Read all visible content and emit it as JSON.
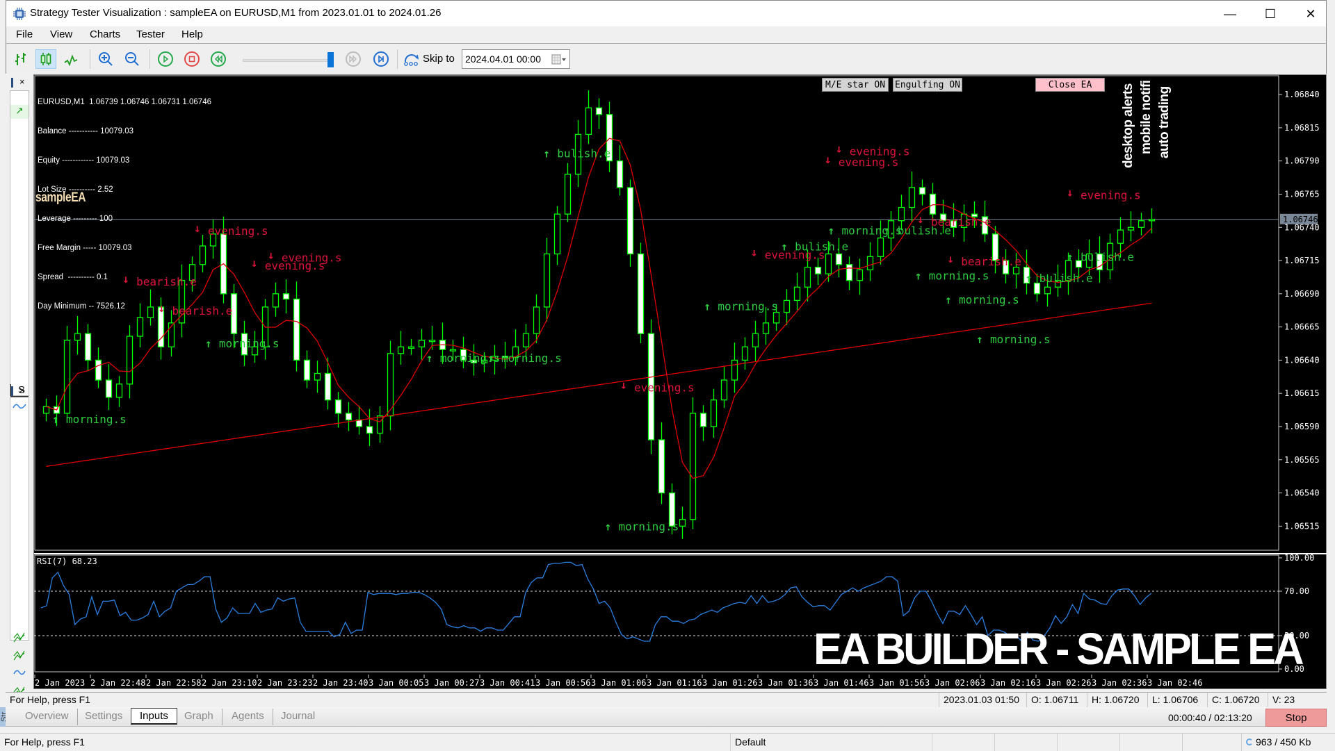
{
  "window": {
    "title": "Strategy Tester Visualization : sampleEA on EURUSD,M1 from 2023.01.01 to 2024.01.26",
    "minimize": "—",
    "maximize": "☐",
    "close": "✕"
  },
  "menu": [
    "File",
    "View",
    "Charts",
    "Tester",
    "Help"
  ],
  "toolbar": {
    "buttons": [
      "bar-chart",
      "candlestick-chart",
      "line-chart",
      "zoom-in",
      "zoom-out",
      "play",
      "stop",
      "rewind",
      "fast-forward",
      "step-to-end"
    ],
    "speed_slider_value": 0.95,
    "skip_label": "Skip to",
    "skip_value": "2024.04.01 00:00"
  },
  "chart_info": {
    "symbol_line": "EURUSD,M1  1.06739 1.06746 1.06731 1.06746",
    "lines": [
      "Balance ----------- 10079.03",
      "Equity ------------ 10079.03",
      "Lot Size ---------- 2.52",
      "Leverage --------- 100",
      "Free Margin ----- 10079.03",
      "Spread  ---------- 0.1",
      "Day Minimum -- 7526.12"
    ],
    "ea_name": "sampleEA"
  },
  "chart_buttons": {
    "me_star": "M/E star ON",
    "engulfing": "Engulfing ON",
    "close_ea": "Close EA"
  },
  "vertical_labels": [
    "desktop alerts",
    "mobile notifi",
    "auto trading"
  ],
  "watermark": "EA BUILDER - SAMPLE EA",
  "chart_data": [
    {
      "type": "candlestick",
      "title": "EURUSD,M1",
      "current_price": "1.06746",
      "y_ticks": [
        "1.06840",
        "1.06815",
        "1.06790",
        "1.06765",
        "1.06740",
        "1.06715",
        "1.06690",
        "1.06665",
        "1.06640",
        "1.06615",
        "1.06590",
        "1.06565",
        "1.06540",
        "1.06515"
      ],
      "ylim": [
        1.065,
        1.0685
      ],
      "x_ticks": [
        "2 Jan 2023",
        "2 Jan 22:48",
        "2 Jan 22:58",
        "2 Jan 23:10",
        "2 Jan 23:23",
        "2 Jan 23:40",
        "3 Jan 00:05",
        "3 Jan 00:27",
        "3 Jan 00:41",
        "3 Jan 00:56",
        "3 Jan 01:06",
        "3 Jan 01:16",
        "3 Jan 01:26",
        "3 Jan 01:36",
        "3 Jan 01:46",
        "3 Jan 01:56",
        "3 Jan 02:06",
        "3 Jan 02:16",
        "3 Jan 02:26",
        "3 Jan 02:36",
        "3 Jan 02:46"
      ],
      "close_series": [
        1.06605,
        1.066,
        1.06655,
        1.0666,
        1.0664,
        1.06625,
        1.06612,
        1.06622,
        1.06658,
        1.06672,
        1.0668,
        1.0665,
        1.06668,
        1.067,
        1.06712,
        1.06726,
        1.06735,
        1.0669,
        1.0666,
        1.06644,
        1.0665,
        1.0668,
        1.0669,
        1.06686,
        1.0664,
        1.06625,
        1.0663,
        1.0661,
        1.066,
        1.06595,
        1.0659,
        1.06585,
        1.06598,
        1.06645,
        1.0665,
        1.0665,
        1.06655,
        1.06655,
        1.06648,
        1.06648,
        1.0664,
        1.06638,
        1.0664,
        1.06643,
        1.06642,
        1.0665,
        1.0666,
        1.0668,
        1.0672,
        1.0675,
        1.0678,
        1.0681,
        1.0683,
        1.06825,
        1.0679,
        1.0677,
        1.0672,
        1.0666,
        1.0658,
        1.0654,
        1.06515,
        1.0652,
        1.066,
        1.0659,
        1.0661,
        1.06625,
        1.0664,
        1.0665,
        1.0666,
        1.06668,
        1.06676,
        1.06685,
        1.06695,
        1.0671,
        1.06705,
        1.0672,
        1.06712,
        1.067,
        1.06708,
        1.06718,
        1.06732,
        1.06745,
        1.06755,
        1.0677,
        1.06765,
        1.0675,
        1.06745,
        1.0674,
        1.0675,
        1.06748,
        1.06735,
        1.06715,
        1.06705,
        1.0671,
        1.06698,
        1.0669,
        1.06695,
        1.067,
        1.06715,
        1.0671,
        1.0672,
        1.06708,
        1.06728,
        1.06738,
        1.0674,
        1.06745,
        1.06746
      ],
      "ma_fast_color": "#e00000",
      "ma_slow_color": "#e00000",
      "annotations": [
        {
          "text": "evening.s",
          "kind": "sell",
          "x": 0.137,
          "price": 1.06728
        },
        {
          "text": "bearish.e",
          "kind": "sell",
          "x": 0.073,
          "price": 1.0669
        },
        {
          "text": "bearish.e",
          "kind": "sell",
          "x": 0.105,
          "price": 1.06668
        },
        {
          "text": "evening.s",
          "kind": "sell",
          "x": 0.188,
          "price": 1.06702
        },
        {
          "text": "evening.s",
          "kind": "sell",
          "x": 0.203,
          "price": 1.06708
        },
        {
          "text": "morning.s",
          "kind": "buy",
          "x": 0.147,
          "price": 1.06657
        },
        {
          "text": "morning.s",
          "kind": "buy",
          "x": 0.01,
          "price": 1.066
        },
        {
          "text": "morning.s",
          "kind": "buy",
          "x": 0.345,
          "price": 1.06646
        },
        {
          "text": "morning.s",
          "kind": "buy",
          "x": 0.4,
          "price": 1.06646
        },
        {
          "text": "bulish.e",
          "kind": "buy",
          "x": 0.45,
          "price": 1.068
        },
        {
          "text": "evening.s",
          "kind": "sell",
          "x": 0.519,
          "price": 1.0661
        },
        {
          "text": "morning.s",
          "kind": "buy",
          "x": 0.505,
          "price": 1.06519
        },
        {
          "text": "morning.s",
          "kind": "buy",
          "x": 0.594,
          "price": 1.06685
        },
        {
          "text": "evening.s",
          "kind": "sell",
          "x": 0.636,
          "price": 1.0671
        },
        {
          "text": "bulish.e",
          "kind": "buy",
          "x": 0.663,
          "price": 1.0673
        },
        {
          "text": "evening.s",
          "kind": "sell",
          "x": 0.702,
          "price": 1.0678
        },
        {
          "text": "evening.s",
          "kind": "sell",
          "x": 0.712,
          "price": 1.06788
        },
        {
          "text": "morning.s",
          "kind": "buy",
          "x": 0.705,
          "price": 1.06742
        },
        {
          "text": "bulish.e",
          "kind": "buy",
          "x": 0.755,
          "price": 1.06742
        },
        {
          "text": "bearish.e",
          "kind": "sell",
          "x": 0.785,
          "price": 1.06735
        },
        {
          "text": "morning.s",
          "kind": "buy",
          "x": 0.783,
          "price": 1.06708
        },
        {
          "text": "bearish.e",
          "kind": "sell",
          "x": 0.812,
          "price": 1.06705
        },
        {
          "text": "morning.s",
          "kind": "buy",
          "x": 0.81,
          "price": 1.0669
        },
        {
          "text": "morning.s",
          "kind": "buy",
          "x": 0.838,
          "price": 1.0666
        },
        {
          "text": "bulish.e",
          "kind": "buy",
          "x": 0.882,
          "price": 1.06706
        },
        {
          "text": "evening.s",
          "kind": "sell",
          "x": 0.919,
          "price": 1.06755
        },
        {
          "text": "bulish.e",
          "kind": "buy",
          "x": 0.919,
          "price": 1.06722
        }
      ]
    },
    {
      "type": "line",
      "title": "RSI(7) 68.23",
      "y_ticks": [
        "100.00",
        "70.00",
        "30.00",
        "0.00"
      ],
      "ylim": [
        0,
        100
      ],
      "levels": [
        70,
        30
      ],
      "series": [
        {
          "name": "RSI(7)",
          "color": "#2a7fe0",
          "values": [
            55,
            57,
            82,
            87,
            75,
            67,
            40,
            45,
            47,
            65,
            49,
            61,
            61,
            62,
            48,
            51,
            44,
            44,
            46,
            49,
            61,
            47,
            52,
            55,
            70,
            73,
            76,
            76,
            79,
            83,
            83,
            54,
            42,
            46,
            55,
            50,
            50,
            50,
            59,
            51,
            53,
            54,
            64,
            61,
            63,
            64,
            42,
            34,
            34,
            34,
            34,
            34,
            29,
            31,
            42,
            32,
            35,
            35,
            69,
            67,
            68,
            68,
            68,
            67,
            68,
            68,
            69,
            69,
            67,
            64,
            60,
            54,
            40,
            38,
            37,
            39,
            37,
            37,
            34,
            37,
            37,
            35,
            35,
            41,
            47,
            47,
            69,
            78,
            82,
            82,
            94,
            95,
            95,
            96,
            96,
            93,
            94,
            81,
            72,
            59,
            61,
            55,
            42,
            31,
            27,
            29,
            27,
            25,
            25,
            40,
            47,
            47,
            43,
            43,
            41,
            44,
            45,
            49,
            51,
            53,
            51,
            55,
            57,
            59,
            60,
            59,
            66,
            59,
            66,
            60,
            61,
            63,
            67,
            73,
            74,
            65,
            60,
            56,
            57,
            57,
            53,
            60,
            67,
            70,
            73,
            70,
            73,
            75,
            77,
            79,
            83,
            83,
            79,
            48,
            52,
            64,
            70,
            70,
            61,
            50,
            41,
            52,
            52,
            49,
            57,
            49,
            40,
            47,
            30,
            35,
            35,
            33,
            29,
            30,
            25,
            33,
            26,
            25,
            30,
            37,
            48,
            41,
            47,
            58,
            50,
            68,
            63,
            62,
            59,
            58,
            66,
            71,
            72,
            72,
            66,
            58,
            64,
            68.23
          ]
        }
      ]
    }
  ],
  "status": {
    "help": "For Help, press F1",
    "datetime": "2023.01.03 01:50",
    "open": "O: 1.06711",
    "high": "H: 1.06720",
    "low": "L: 1.06706",
    "close": "C: 1.06720",
    "volume": "V: 23"
  },
  "tester": {
    "strip_label": "Str",
    "tabs": [
      "Overview",
      "Settings",
      "Inputs",
      "Graph",
      "Agents",
      "Journal"
    ],
    "active_tab": "Inputs",
    "progress": "00:00:40 / 02:13:20",
    "stop_label": "Stop"
  },
  "bottom_status": {
    "help": "For Help, press F1",
    "profile": "Default",
    "traffic": "963 / 450 Kb"
  },
  "left_panels": {
    "top_close": "×",
    "top_label": "S",
    "bottom_close": "×"
  }
}
